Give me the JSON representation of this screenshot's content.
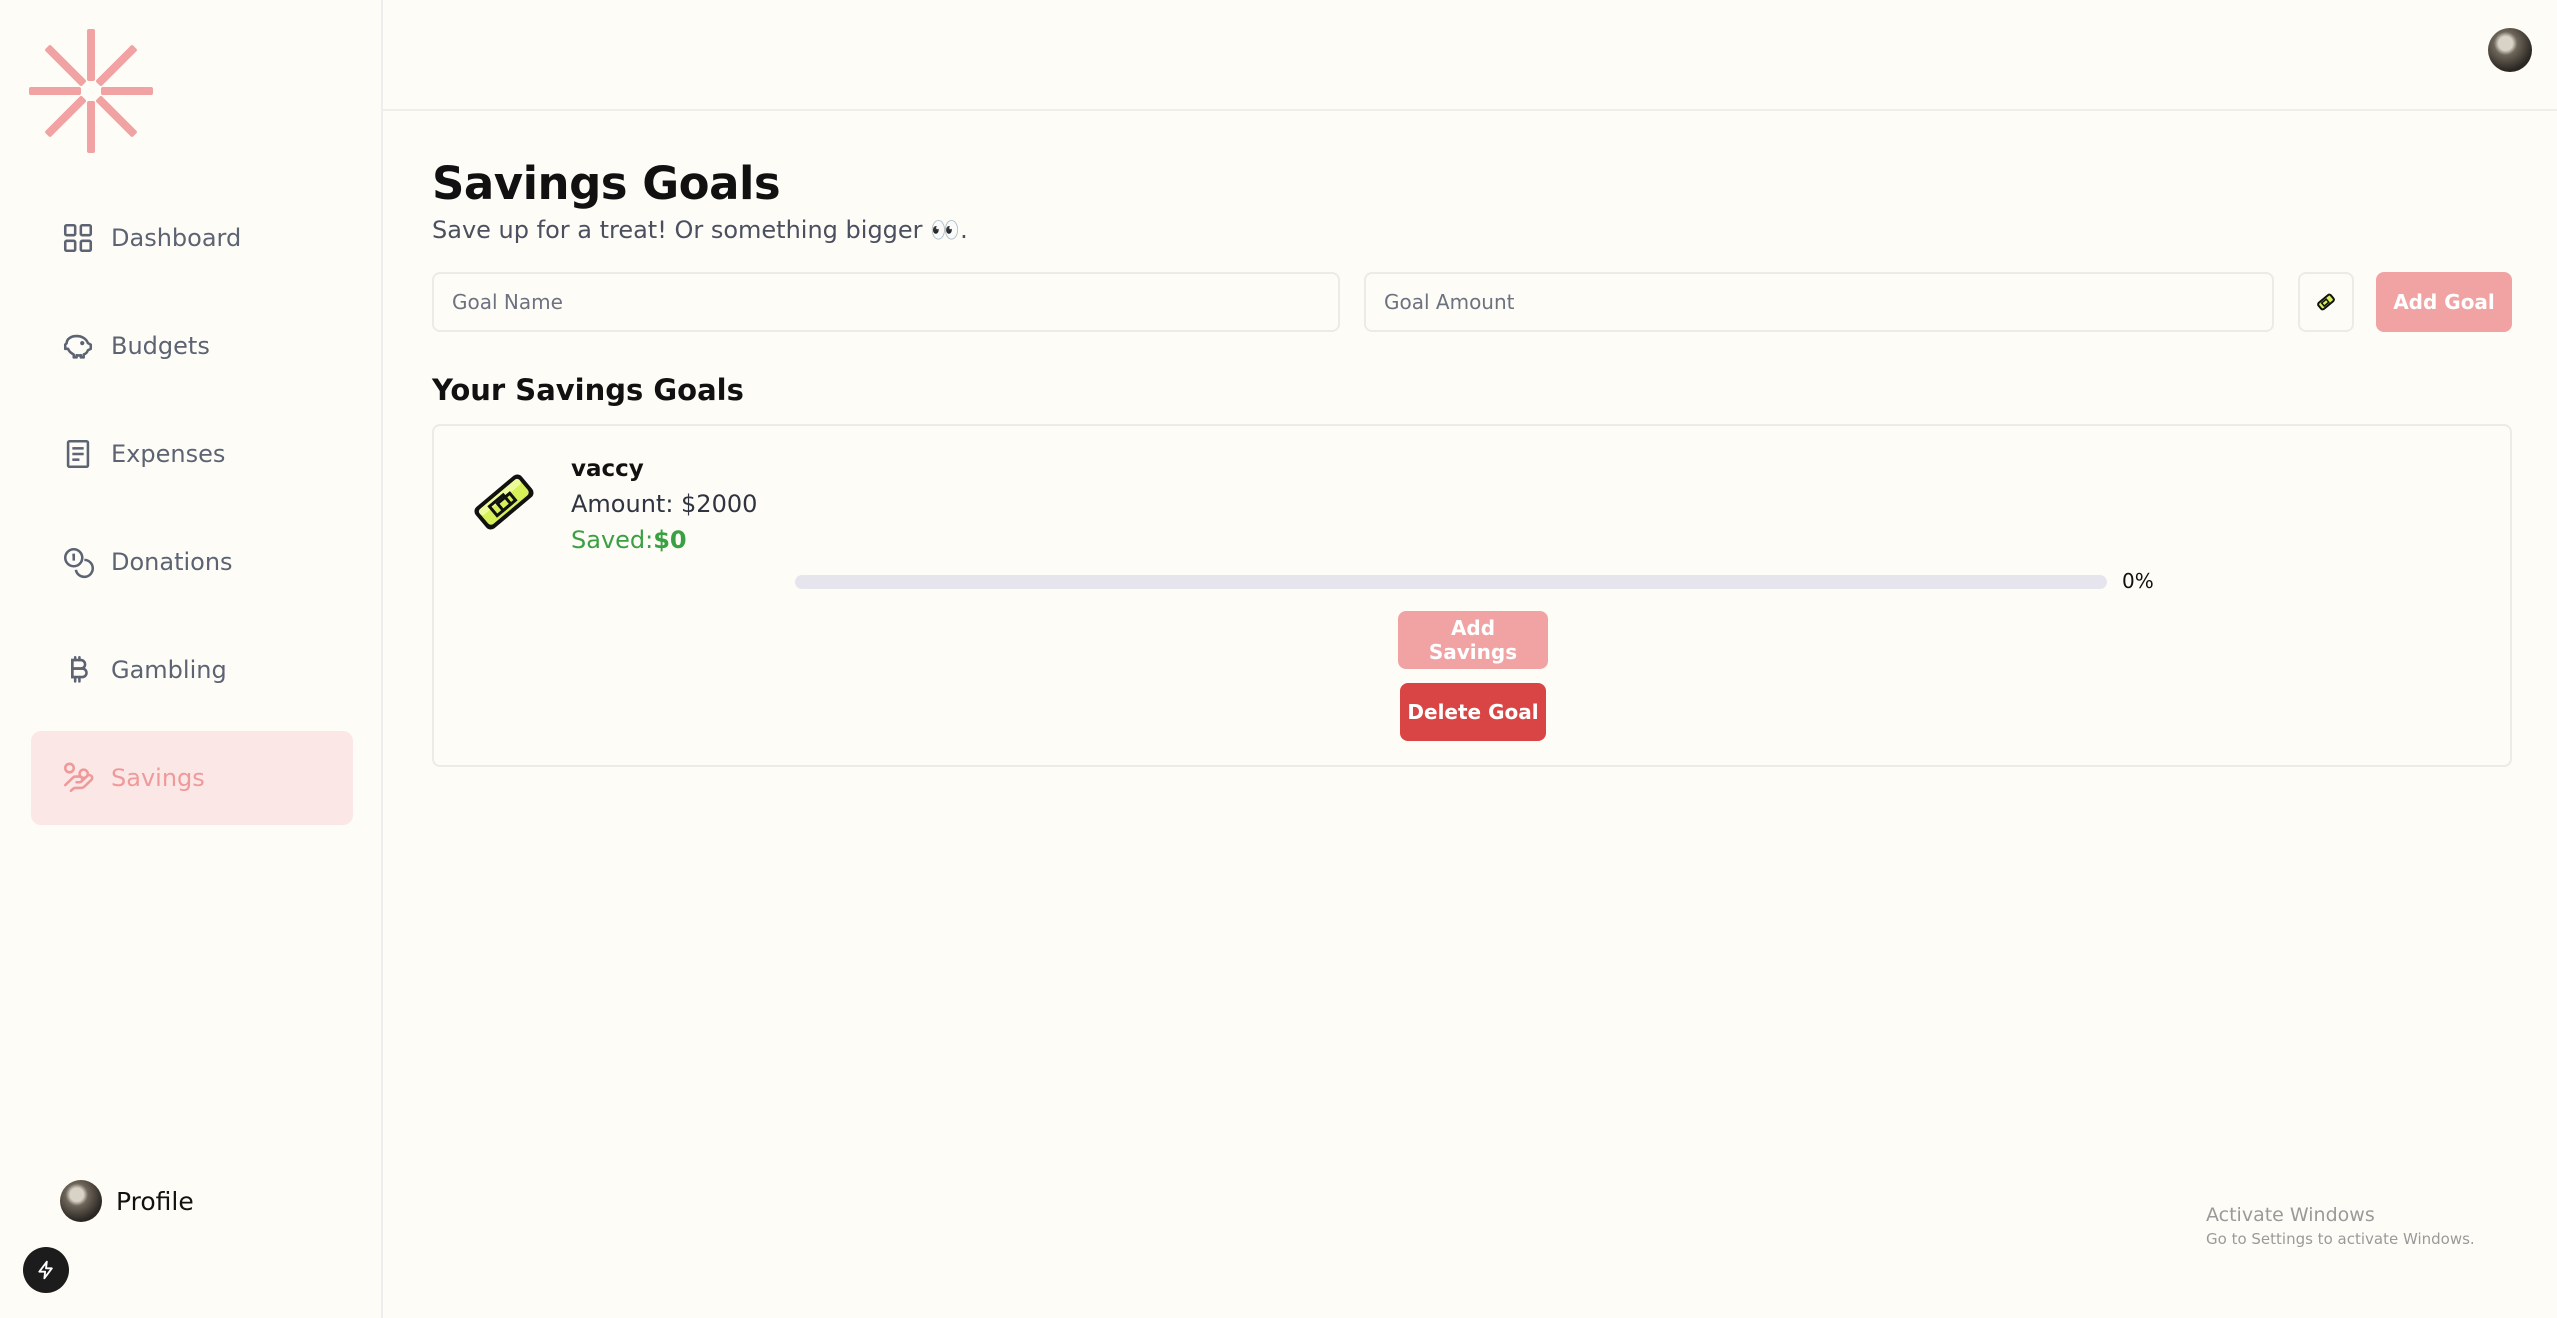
{
  "colors": {
    "background": "#fefcf6",
    "accent": "#ef9a9a",
    "button_pink": "#f1a3a3",
    "danger": "#d94545",
    "success": "#3aa043",
    "active_nav_bg": "#fbe7e6"
  },
  "sidebar": {
    "logo_icon": "asterisk-burst-icon",
    "items": [
      {
        "label": "Dashboard",
        "icon": "grid-icon"
      },
      {
        "label": "Budgets",
        "icon": "piggy-bank-icon"
      },
      {
        "label": "Expenses",
        "icon": "receipt-icon"
      },
      {
        "label": "Donations",
        "icon": "coins-icon"
      },
      {
        "label": "Gambling",
        "icon": "bitcoin-icon"
      },
      {
        "label": "Savings",
        "icon": "hand-coins-icon",
        "active": true
      }
    ],
    "profile_label": "Profile"
  },
  "page": {
    "title": "Savings Goals",
    "subtitle": "Save up for a treat! Or something bigger",
    "subtitle_emoji": "👀",
    "subtitle_end": "."
  },
  "form": {
    "goal_name_placeholder": "Goal Name",
    "goal_amount_placeholder": "Goal Amount",
    "emoji_picker_icon": "pencil-emoji-icon",
    "add_goal_label": "Add Goal"
  },
  "goals_section": {
    "heading": "Your Savings Goals",
    "goals": [
      {
        "name": "vaccy",
        "amount_text": "Amount: $2000",
        "saved_label": "Saved:",
        "saved_value": "$0",
        "progress_percent": 0,
        "progress_text": "0%",
        "add_savings_label": "Add Savings",
        "delete_label": "Delete Goal"
      }
    ]
  },
  "watermark": {
    "line1": "Activate Windows",
    "line2": "Go to Settings to activate Windows."
  }
}
